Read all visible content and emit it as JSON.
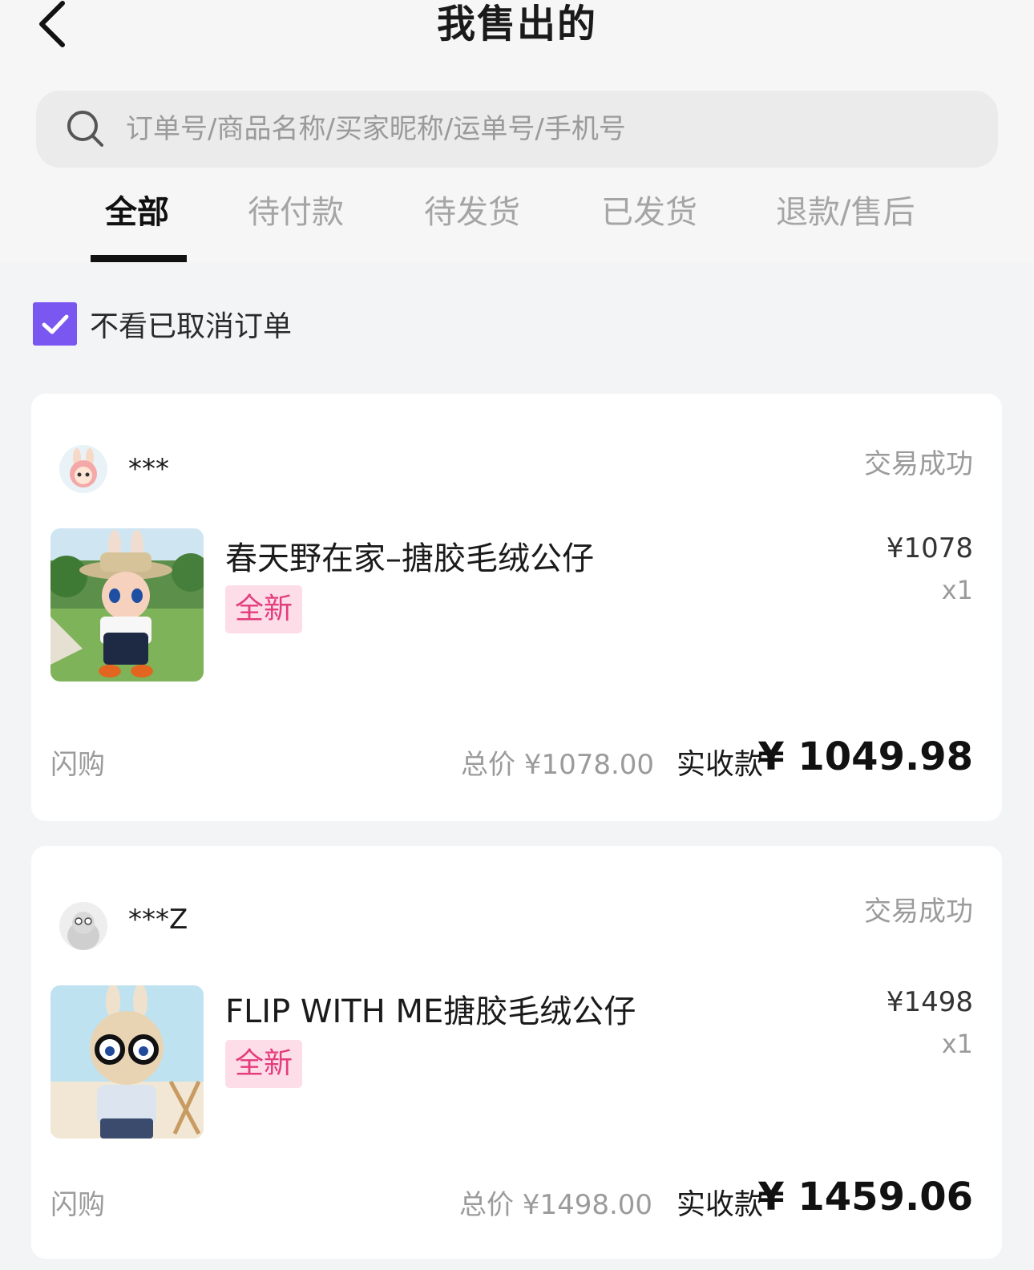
{
  "header": {
    "title": "我售出的"
  },
  "search": {
    "placeholder": "订单号/商品名称/买家昵称/运单号/手机号"
  },
  "tabs": [
    {
      "label": "全部",
      "active": true
    },
    {
      "label": "待付款",
      "active": false
    },
    {
      "label": "待发货",
      "active": false
    },
    {
      "label": "已发货",
      "active": false
    },
    {
      "label": "退款/售后",
      "active": false
    }
  ],
  "filter": {
    "label": "不看已取消订单",
    "checked": true,
    "accent_color": "#7a57f0"
  },
  "orders": [
    {
      "buyer": "***",
      "status": "交易成功",
      "product_name": "春天野在家–搪胶毛绒公仔",
      "condition": "全新",
      "unit_price": "¥1078",
      "quantity": "x1",
      "channel": "闪购",
      "total_label": "总价 ¥1078.00",
      "received_label": "实收款",
      "received_amount": "¥ 1049.98"
    },
    {
      "buyer": "***Z",
      "status": "交易成功",
      "product_name": "FLIP WITH ME搪胶毛绒公仔",
      "condition": "全新",
      "unit_price": "¥1498",
      "quantity": "x1",
      "channel": "闪购",
      "total_label": "总价 ¥1498.00",
      "received_label": "实收款",
      "received_amount": "¥ 1459.06"
    }
  ],
  "colors": {
    "badge_bg": "#fcdde8",
    "badge_text": "#e43d7c",
    "status_text": "#9b9b9b"
  }
}
